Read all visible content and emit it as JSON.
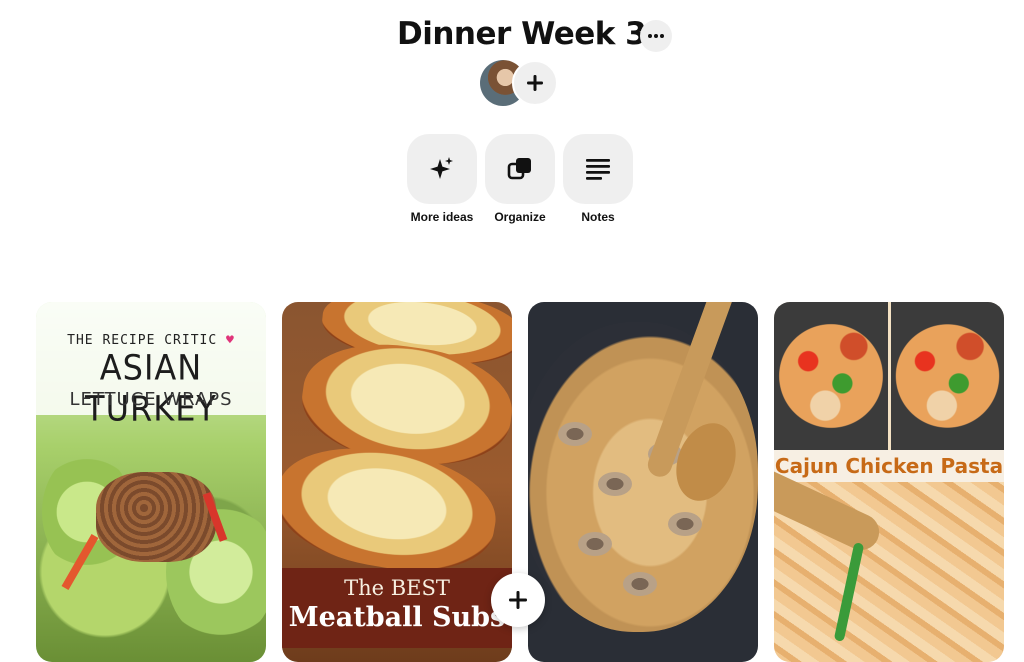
{
  "board": {
    "title": "Dinner Week 3",
    "more_icon": "ellipsis-icon",
    "collaborators": {
      "avatar": "user-avatar",
      "add_icon": "plus-icon"
    }
  },
  "actions": [
    {
      "label": "More ideas",
      "icon": "sparkle-icon"
    },
    {
      "label": "Organize",
      "icon": "organize-icon"
    },
    {
      "label": "Notes",
      "icon": "notes-icon"
    }
  ],
  "pins": [
    {
      "brand": "THE RECIPE CRITIC",
      "title_line1": "ASIAN TURKEY",
      "title_line2": "LETTUCE WRAPS"
    },
    {
      "title_line1": "The BEST",
      "title_line2": "Meatball Subs"
    },
    {
      "image": "crockpot-chicken-mushroom"
    },
    {
      "title": "Cajun Chicken Pasta"
    }
  ],
  "floating_button": {
    "icon": "plus-icon"
  },
  "colors": {
    "button_bg": "#efefef",
    "text": "#111111",
    "heart": "#e0347a",
    "subs_banner": "#6f2415",
    "cajun_title": "#c76a17"
  }
}
